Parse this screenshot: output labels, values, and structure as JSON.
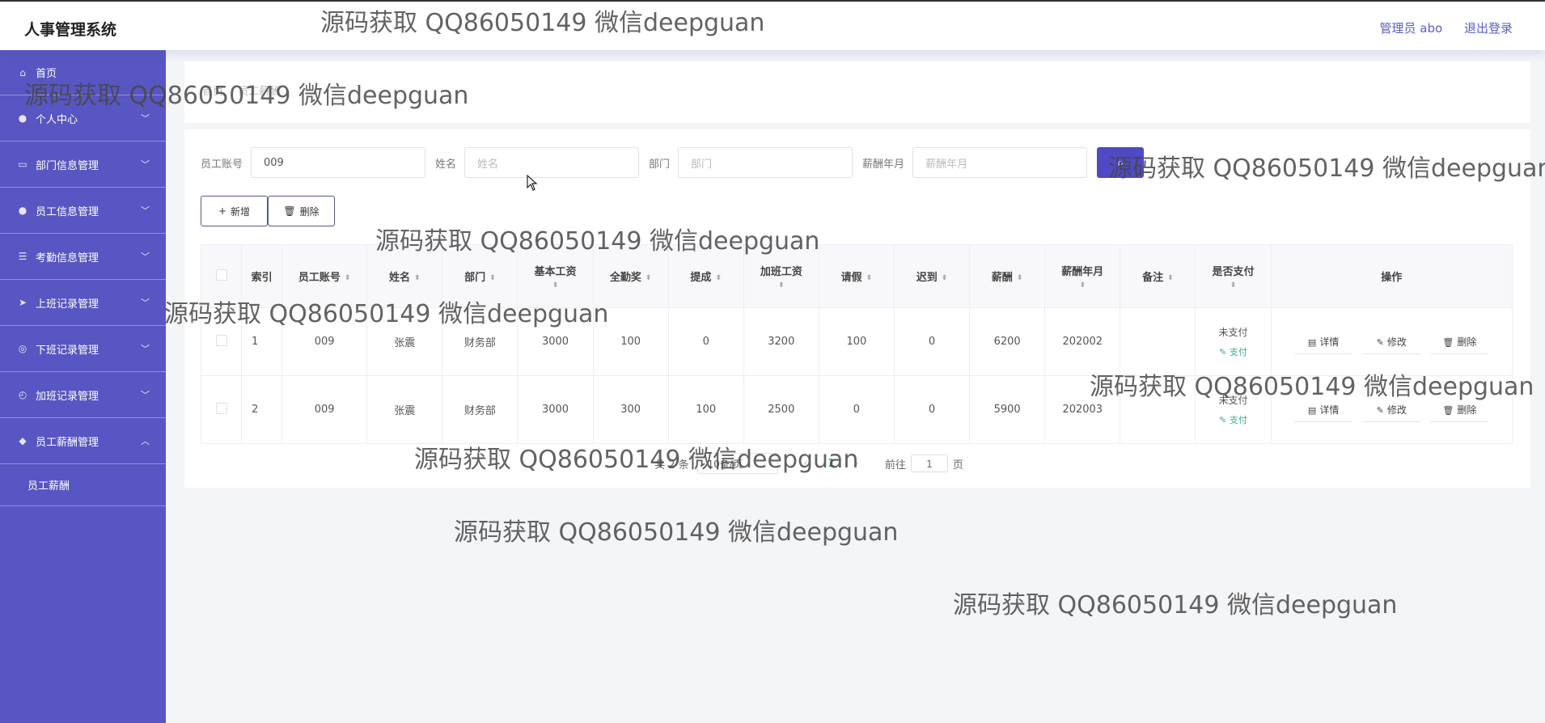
{
  "header": {
    "app_title": "人事管理系统",
    "admin_label": "管理员 abo",
    "logout_label": "退出登录"
  },
  "sidebar": {
    "items": [
      {
        "label": "首页",
        "icon": "home-icon",
        "expandable": false
      },
      {
        "label": "个人中心",
        "icon": "user-icon",
        "expandable": true
      },
      {
        "label": "部门信息管理",
        "icon": "card-icon",
        "expandable": true
      },
      {
        "label": "员工信息管理",
        "icon": "person-icon",
        "expandable": true
      },
      {
        "label": "考勤信息管理",
        "icon": "list-icon",
        "expandable": true
      },
      {
        "label": "上班记录管理",
        "icon": "send-icon",
        "expandable": true
      },
      {
        "label": "下班记录管理",
        "icon": "target-icon",
        "expandable": true
      },
      {
        "label": "加班记录管理",
        "icon": "compass-icon",
        "expandable": true
      },
      {
        "label": "员工薪酬管理",
        "icon": "chip-icon",
        "expandable": true,
        "expanded": true
      }
    ],
    "subitems": [
      {
        "label": "员工薪酬"
      }
    ]
  },
  "breadcrumb": {
    "items": [
      "首页",
      "员工薪酬"
    ]
  },
  "search": {
    "account_label": "员工账号",
    "account_value": "009",
    "name_label": "姓名",
    "name_placeholder": "姓名",
    "dept_label": "部门",
    "dept_placeholder": "部门",
    "month_label": "薪酬年月",
    "month_placeholder": "薪酬年月"
  },
  "actions": {
    "add_label": "新增",
    "delete_label": "删除"
  },
  "table": {
    "headers": {
      "index": "索引",
      "account": "员工账号",
      "name": "姓名",
      "dept": "部门",
      "base": "基本工资",
      "attendance_bonus": "全勤奖",
      "commission": "提成",
      "overtime": "加班工资",
      "leave": "请假",
      "late": "迟到",
      "salary": "薪酬",
      "month": "薪酬年月",
      "remark": "备注",
      "paid": "是否支付",
      "ops": "操作"
    },
    "rows": [
      {
        "index": "1",
        "account": "009",
        "name": "张震",
        "dept": "财务部",
        "base": "3000",
        "attendance_bonus": "100",
        "commission": "0",
        "overtime": "3200",
        "leave": "100",
        "late": "0",
        "salary": "6200",
        "month": "202002",
        "remark": "",
        "paid": "未支付",
        "pay_link": "支付"
      },
      {
        "index": "2",
        "account": "009",
        "name": "张震",
        "dept": "财务部",
        "base": "3000",
        "attendance_bonus": "300",
        "commission": "100",
        "overtime": "2500",
        "leave": "0",
        "late": "0",
        "salary": "5900",
        "month": "202003",
        "remark": "",
        "paid": "未支付",
        "pay_link": "支付"
      }
    ],
    "op_labels": {
      "detail": "详情",
      "edit": "修改",
      "delete": "删除"
    }
  },
  "pagination": {
    "total": "共 2 条",
    "page_size": "10条/页",
    "current_page": "1",
    "goto_label": "前往",
    "goto_value": "1",
    "page_suffix": "页"
  },
  "watermark": "源码获取 QQ86050149 微信deepguan",
  "colors": {
    "sidebar": "#5856c2",
    "primary": "#5049c4",
    "pay_link": "#35b27f"
  }
}
